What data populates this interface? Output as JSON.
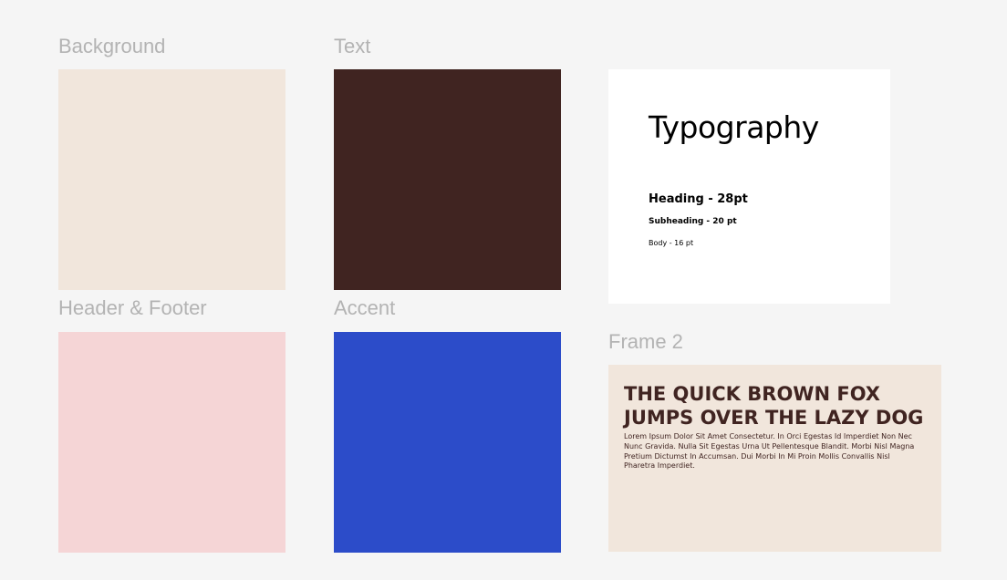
{
  "palette": {
    "background": {
      "label": "Background",
      "color": "#f1e6dc"
    },
    "text": {
      "label": "Text",
      "color": "#402421"
    },
    "header_footer": {
      "label": "Header & Footer",
      "color": "#f5d5d6"
    },
    "accent": {
      "label": "Accent",
      "color": "#2c4cc9"
    }
  },
  "typography": {
    "title": "Typography",
    "heading": "Heading - 28pt",
    "subheading": "Subheading - 20 pt",
    "body": "Body - 16 pt"
  },
  "frame2": {
    "label": "Frame 2",
    "heading": "THE QUICK BROWN FOX JUMPS OVER THE LAZY DOG",
    "body": "Lorem Ipsum Dolor Sit Amet Consectetur. In Orci Egestas Id Imperdiet Non Nec Nunc Gravida. Nulla Sit Egestas Urna Ut Pellentesque Blandit. Morbi Nisl Magna Pretium Dictumst In Accumsan. Dui Morbi In Mi Proin Mollis Convallis Nisl Pharetra Imperdiet."
  }
}
